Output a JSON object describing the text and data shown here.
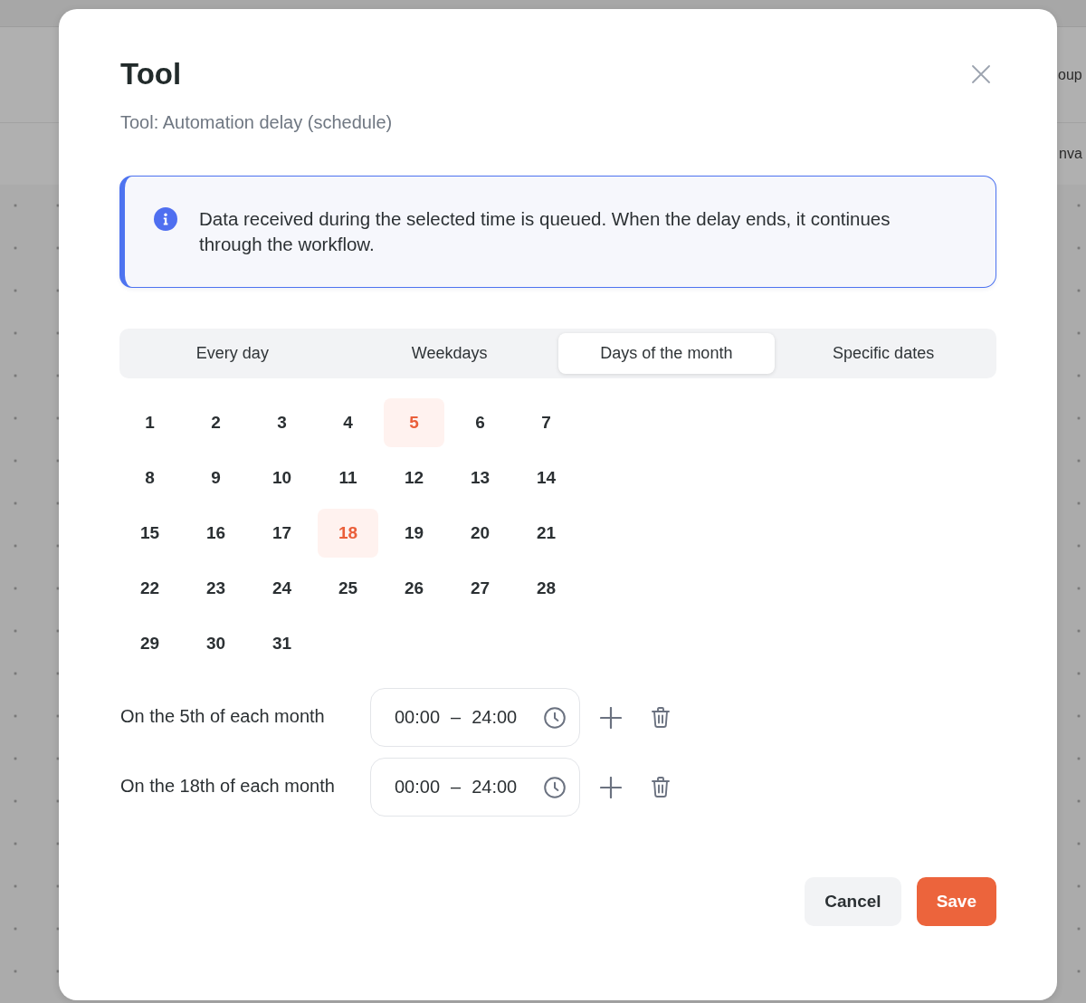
{
  "page": {
    "header_text": "oup",
    "toolbar_text": "nva"
  },
  "dialog": {
    "title": "Tool",
    "subtitle": "Tool: Automation delay (schedule)"
  },
  "notice": {
    "text": "Data received during the selected time is queued. When the delay ends, it continues through the workflow."
  },
  "tabs": [
    {
      "label": "Every day",
      "selected": false
    },
    {
      "label": "Weekdays",
      "selected": false
    },
    {
      "label": "Days of the month",
      "selected": true
    },
    {
      "label": "Specific dates",
      "selected": false
    }
  ],
  "days": [
    {
      "label": "1",
      "selected": false
    },
    {
      "label": "2",
      "selected": false
    },
    {
      "label": "3",
      "selected": false
    },
    {
      "label": "4",
      "selected": false
    },
    {
      "label": "5",
      "selected": true
    },
    {
      "label": "6",
      "selected": false
    },
    {
      "label": "7",
      "selected": false
    },
    {
      "label": "8",
      "selected": false
    },
    {
      "label": "9",
      "selected": false
    },
    {
      "label": "10",
      "selected": false
    },
    {
      "label": "11",
      "selected": false
    },
    {
      "label": "12",
      "selected": false
    },
    {
      "label": "13",
      "selected": false
    },
    {
      "label": "14",
      "selected": false
    },
    {
      "label": "15",
      "selected": false
    },
    {
      "label": "16",
      "selected": false
    },
    {
      "label": "17",
      "selected": false
    },
    {
      "label": "18",
      "selected": true
    },
    {
      "label": "19",
      "selected": false
    },
    {
      "label": "20",
      "selected": false
    },
    {
      "label": "21",
      "selected": false
    },
    {
      "label": "22",
      "selected": false
    },
    {
      "label": "23",
      "selected": false
    },
    {
      "label": "24",
      "selected": false
    },
    {
      "label": "25",
      "selected": false
    },
    {
      "label": "26",
      "selected": false
    },
    {
      "label": "27",
      "selected": false
    },
    {
      "label": "28",
      "selected": false
    },
    {
      "label": "29",
      "selected": false
    },
    {
      "label": "30",
      "selected": false
    },
    {
      "label": "31",
      "selected": false
    }
  ],
  "schedules": [
    {
      "label": "On the 5th of each month",
      "start": "00:00",
      "separator": "–",
      "end": "24:00"
    },
    {
      "label": "On the 18th of each month",
      "start": "00:00",
      "separator": "–",
      "end": "24:00"
    }
  ],
  "buttons": [
    {
      "label": "Cancel",
      "kind": "secondary"
    },
    {
      "label": "Save",
      "kind": "primary"
    }
  ]
}
